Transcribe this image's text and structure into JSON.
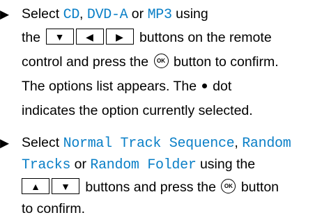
{
  "colors": {
    "highlight": "#0a7fc7"
  },
  "steps": [
    {
      "lines": [
        {
          "parts": [
            "Select ",
            "CD",
            ", ",
            "DVD-A",
            " or ",
            "MP3",
            " using"
          ]
        },
        {
          "before": "the",
          "buttons": [
            "▼",
            "◀",
            "▶"
          ],
          "after": "buttons on the remote"
        },
        {
          "before": "control and press the",
          "ok": "OK",
          "after": "button to confirm."
        },
        {
          "text": "The options list appears. The",
          "dot_after": "dot"
        },
        {
          "text": "indicates the option currently selected."
        }
      ]
    },
    {
      "lines": [
        {
          "parts": [
            "Select ",
            "Normal Track Sequence",
            ", ",
            "Random"
          ]
        },
        {
          "parts": [
            "Tracks",
            " or ",
            "Random Folder",
            " using the"
          ]
        },
        {
          "buttons": [
            "▲",
            "▼"
          ],
          "after": "buttons and press the",
          "ok": "OK",
          "after2": "button"
        },
        {
          "text": "to confirm."
        }
      ]
    }
  ]
}
